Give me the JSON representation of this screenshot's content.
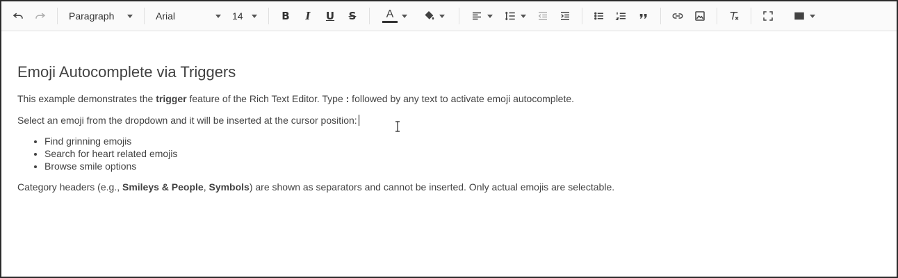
{
  "toolbar": {
    "paragraph_format": "Paragraph",
    "font_family": "Arial",
    "font_size": "14",
    "bold_label": "B",
    "italic_label": "I",
    "underline_label": "U",
    "strike_label": "S",
    "font_color_label": "A"
  },
  "content": {
    "heading": "Emoji Autocomplete via Triggers",
    "p1": {
      "pre": "This example demonstrates the ",
      "bold": "trigger",
      "mid": " feature of the Rich Text Editor. Type ",
      "colon": ":",
      "post": " followed by any text to activate emoji autocomplete."
    },
    "p2": "Select an emoji from the dropdown and it will be inserted at the cursor position:",
    "bullets": [
      "Find grinning emojis",
      "Search for heart related emojis",
      "Browse smile options"
    ],
    "p3": {
      "pre": "Category headers (e.g., ",
      "bold1": "Smileys & People",
      "sep": ", ",
      "bold2": "Symbols",
      "post": ") are shown as separators and cannot be inserted. Only actual emojis are selectable."
    }
  },
  "colors": {
    "border": "#2b2b2b",
    "toolbar_bg": "#fafafa",
    "text": "#424242"
  }
}
